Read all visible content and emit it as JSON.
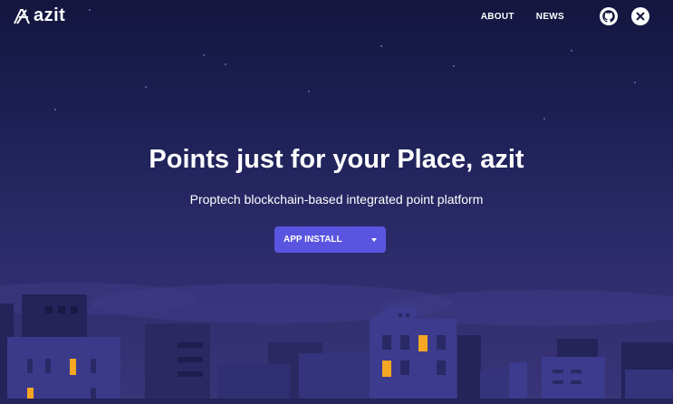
{
  "nav": {
    "logo_text": "azit",
    "links": [
      {
        "label": "ABOUT"
      },
      {
        "label": "NEWS"
      }
    ],
    "icons": [
      "github-icon",
      "x-icon"
    ]
  },
  "hero": {
    "title": "Points just for your Place, azit",
    "subtitle": "Proptech blockchain-based integrated point platform",
    "cta_label": "APP INSTALL"
  },
  "colors": {
    "sky_top": "#14163f",
    "sky_bottom": "#3a3478",
    "button": "#5a55e0",
    "window_lit": "#f5a623"
  }
}
